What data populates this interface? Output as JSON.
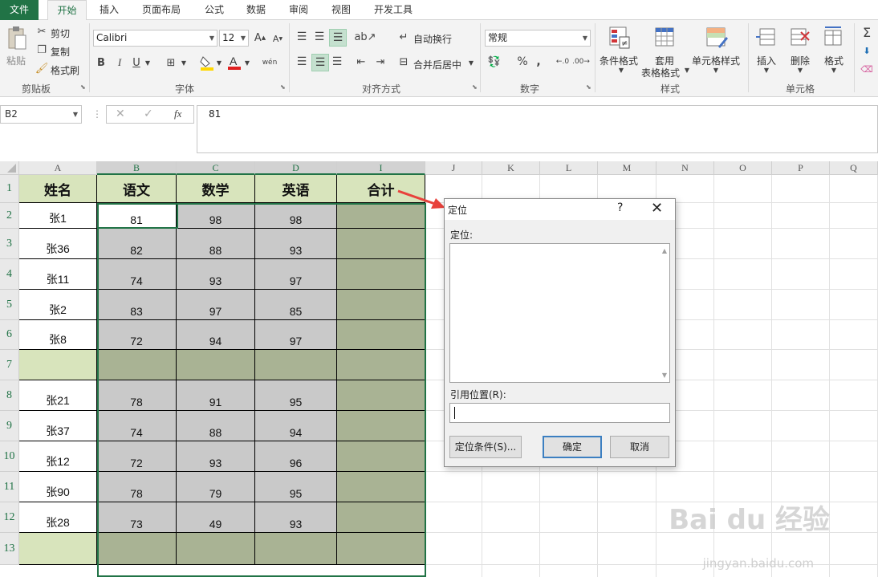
{
  "ribbon_tabs": [
    "文件",
    "开始",
    "插入",
    "页面布局",
    "公式",
    "数据",
    "审阅",
    "视图",
    "开发工具"
  ],
  "clipboard": {
    "paste": "粘贴",
    "cut": "剪切",
    "copy": "复制",
    "format_painter": "格式刷",
    "group": "剪贴板"
  },
  "font": {
    "name": "Calibri",
    "size": "12",
    "bold": "B",
    "italic": "I",
    "underline": "U",
    "group": "字体",
    "phonetic": "wén"
  },
  "alignment": {
    "wrap": "自动换行",
    "merge": "合并后居中",
    "group": "对齐方式"
  },
  "number": {
    "format": "常规",
    "percent": "%",
    "comma": ",",
    "group": "数字"
  },
  "styles": {
    "conditional": "条件格式",
    "table_format_1": "套用",
    "table_format_2": "表格格式",
    "cell_styles": "单元格样式",
    "group": "样式"
  },
  "cells": {
    "insert": "插入",
    "delete": "删除",
    "format": "格式",
    "group": "单元格"
  },
  "formula_bar": {
    "name_box": "B2",
    "content": "81",
    "fx": "fx"
  },
  "columns": [
    "A",
    "B",
    "C",
    "D",
    "I",
    "J",
    "K",
    "L",
    "M",
    "N",
    "O",
    "P",
    "Q"
  ],
  "header_row": [
    "姓名",
    "语文",
    "数学",
    "英语",
    "合计"
  ],
  "rows": [
    {
      "num": "1"
    },
    {
      "num": "2",
      "name": "张1",
      "b": "81",
      "c": "98",
      "d": "98"
    },
    {
      "num": "3",
      "name": "张36",
      "b": "82",
      "c": "88",
      "d": "93"
    },
    {
      "num": "4",
      "name": "张11",
      "b": "74",
      "c": "93",
      "d": "97"
    },
    {
      "num": "5",
      "name": "张2",
      "b": "83",
      "c": "97",
      "d": "85"
    },
    {
      "num": "6",
      "name": "张8",
      "b": "72",
      "c": "94",
      "d": "97"
    },
    {
      "num": "7"
    },
    {
      "num": "8",
      "name": "张21",
      "b": "78",
      "c": "91",
      "d": "95"
    },
    {
      "num": "9",
      "name": "张37",
      "b": "74",
      "c": "88",
      "d": "94"
    },
    {
      "num": "10",
      "name": "张12",
      "b": "72",
      "c": "93",
      "d": "96"
    },
    {
      "num": "11",
      "name": "张90",
      "b": "78",
      "c": "79",
      "d": "95"
    },
    {
      "num": "12",
      "name": "张28",
      "b": "73",
      "c": "49",
      "d": "93"
    },
    {
      "num": "13"
    }
  ],
  "dialog": {
    "title": "定位",
    "help": "?",
    "list_label": "定位:",
    "ref_label": "引用位置(R):",
    "special_button": "定位条件(S)...",
    "ok_button": "确定",
    "cancel_button": "取消"
  },
  "watermark": {
    "brand": "Bai du 经验",
    "url": "jingyan.baidu.com"
  },
  "colors": {
    "excel_green": "#217346",
    "header_fill": "#d8e4bc",
    "gray_fill": "#c9c9c9",
    "olive_fill": "#a9b394",
    "arrow": "#e8413b"
  }
}
